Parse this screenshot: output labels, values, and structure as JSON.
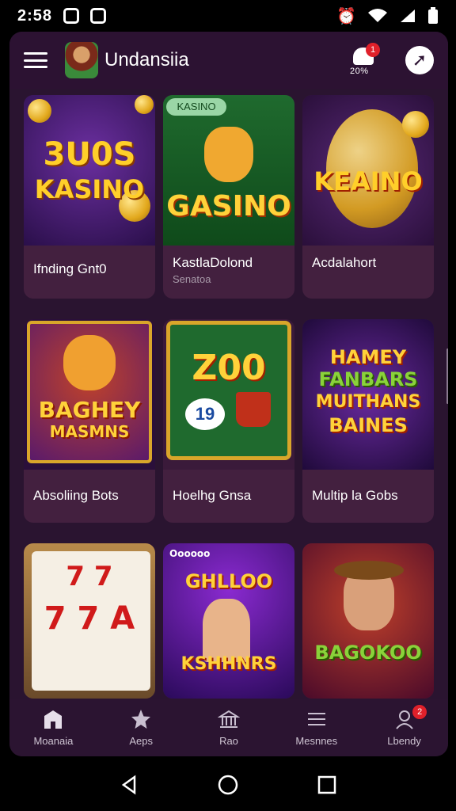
{
  "status_bar": {
    "time": "2:58"
  },
  "header": {
    "title": "Undansiia",
    "notification_badge": "1",
    "notification_sub": "20%"
  },
  "cards": [
    {
      "art_text_1": "3U0S",
      "art_text_2": "KASINO",
      "label": "Ifnding Gnt0",
      "sub": ""
    },
    {
      "tag": "KASINO",
      "art_text_1": "GASINO",
      "label": "KastlaDolond",
      "sub": "Senatoa"
    },
    {
      "art_text_1": "KEAINO",
      "label": "Acdalahort",
      "sub": ""
    },
    {
      "art_text_1": "BAGHEY",
      "art_text_2": "MASMNS",
      "label": "Absoliing Bots",
      "sub": ""
    },
    {
      "art_text_1": "Z00",
      "art_text_2": "19",
      "label": "Hoelhg Gnsa",
      "sub": ""
    },
    {
      "art_text_1": "HAMEY",
      "art_text_2": "FANBARS",
      "art_text_3": "MUITHANS",
      "art_text_4": "BAINES",
      "label": "Multip la Gobs",
      "sub": ""
    },
    {
      "art_text_1": "7 7",
      "art_text_2": "7 7 A",
      "label": "",
      "sub": ""
    },
    {
      "top": "Oooooo",
      "art_text_1": "GHLLOO",
      "art_text_2": "KSHHNRS",
      "label": "",
      "sub": ""
    },
    {
      "art_text_1": "BAGOKOO",
      "label": "",
      "sub": ""
    }
  ],
  "bottom_nav": [
    {
      "label": "Moanaia",
      "icon": "home-icon"
    },
    {
      "label": "Aeps",
      "icon": "star-icon"
    },
    {
      "label": "Rao",
      "icon": "bank-icon"
    },
    {
      "label": "Mesnnes",
      "icon": "menu-icon"
    },
    {
      "label": "Lbendy",
      "icon": "profile-icon",
      "badge": "2"
    }
  ],
  "colors": {
    "app_bg": "#2a1430",
    "card_bg": "#43203f",
    "accent_red": "#e0202a"
  }
}
